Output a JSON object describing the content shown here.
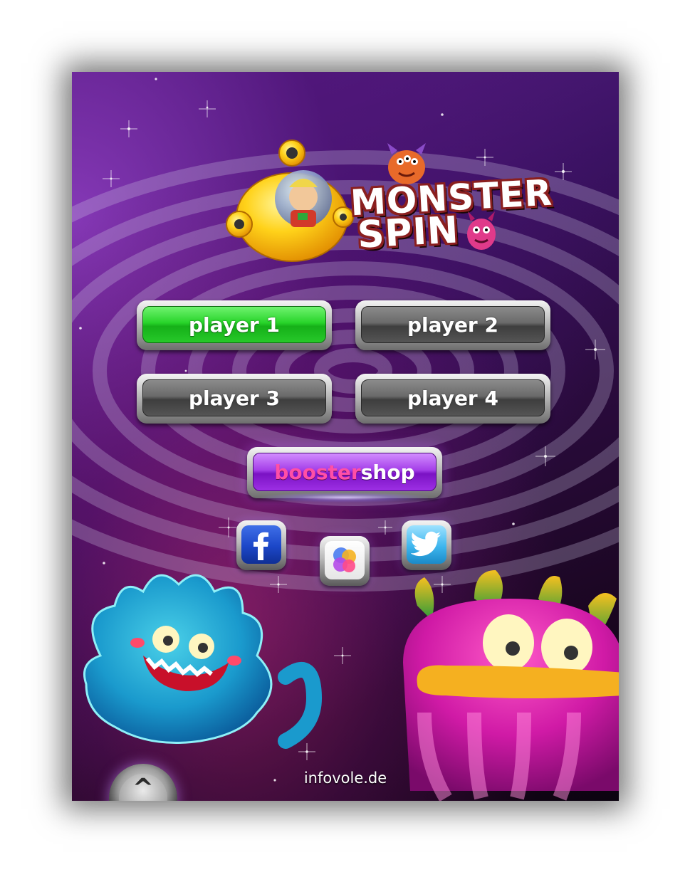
{
  "logo": {
    "line1": "MONSTER",
    "line2": "SPIN"
  },
  "players": [
    {
      "label": "player 1",
      "selected": true
    },
    {
      "label": "player 2",
      "selected": false
    },
    {
      "label": "player 3",
      "selected": false
    },
    {
      "label": "player 4",
      "selected": false
    }
  ],
  "shop": {
    "label_part1": "booster",
    "label_part2": "shop"
  },
  "social": [
    {
      "icon": "facebook-icon"
    },
    {
      "icon": "game-center-icon"
    },
    {
      "icon": "twitter-icon"
    }
  ],
  "footer": {
    "credit": "infovole.de",
    "up_button_glyph": "^"
  },
  "colors": {
    "selected_player": "#28d42a",
    "player_button": "#6a6a6a",
    "shop_button": "#a43fe8",
    "shop_text_pink": "#ff4fa6",
    "facebook": "#1c47c8",
    "twitter": "#3eb6ee",
    "logo_outline": "#8a1f1f",
    "background_purple": "#3a1262"
  }
}
